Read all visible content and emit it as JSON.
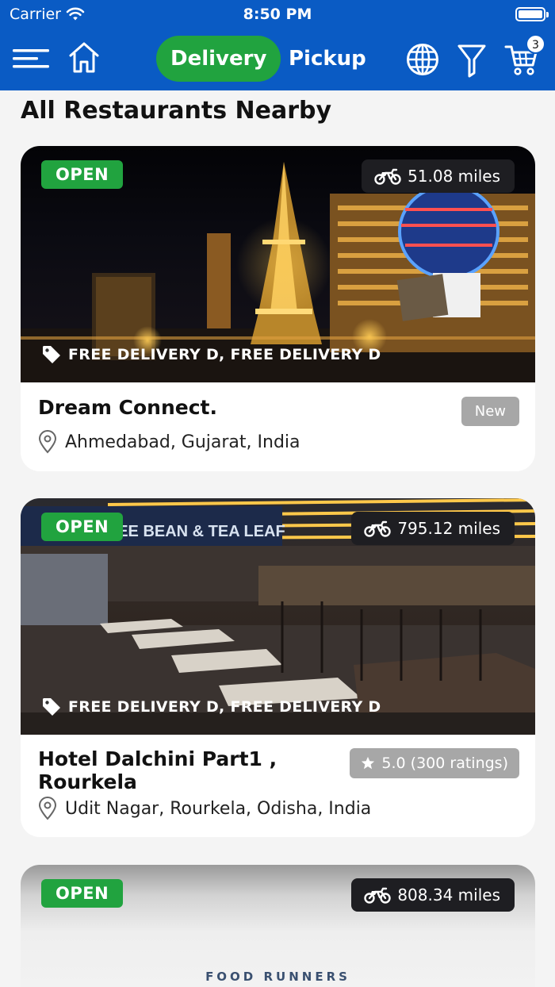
{
  "status_bar": {
    "carrier": "Carrier",
    "time": "8:50 PM"
  },
  "nav": {
    "tabs": [
      {
        "label": "Delivery",
        "active": true
      },
      {
        "label": "Pickup",
        "active": false
      }
    ],
    "cart_count": "3",
    "icons": [
      "menu-icon",
      "home-icon",
      "globe-icon",
      "filter-icon",
      "cart-icon"
    ]
  },
  "section_title": "All Restaurants Nearby",
  "restaurants": [
    {
      "status": "OPEN",
      "distance": "51.08 miles",
      "offer": "FREE DELIVERY D, FREE DELIVERY D",
      "name": "Dream Connect.",
      "address": "Ahmedabad, Gujarat, India",
      "tag": "New"
    },
    {
      "status": "OPEN",
      "distance": "795.12 miles",
      "offer": "FREE DELIVERY D, FREE DELIVERY D",
      "name_line1": "Hotel Dalchini Part1 ,",
      "name_line2": "Rourkela",
      "address": "Udit Nagar, Rourkela, Odisha, India",
      "rating": "5.0 (300 ratings)"
    },
    {
      "status": "OPEN",
      "distance": "808.34 miles",
      "photo_text": "FOOD RUNNERS"
    }
  ],
  "photo_signage": {
    "cafe_sign": "FEE BEAN & TEA LEAF"
  },
  "colors": {
    "header": "#0a5bc4",
    "accent_green": "#21a33f",
    "pill_dark": "#1e1e22",
    "tag_grey": "#a7a7a7"
  }
}
